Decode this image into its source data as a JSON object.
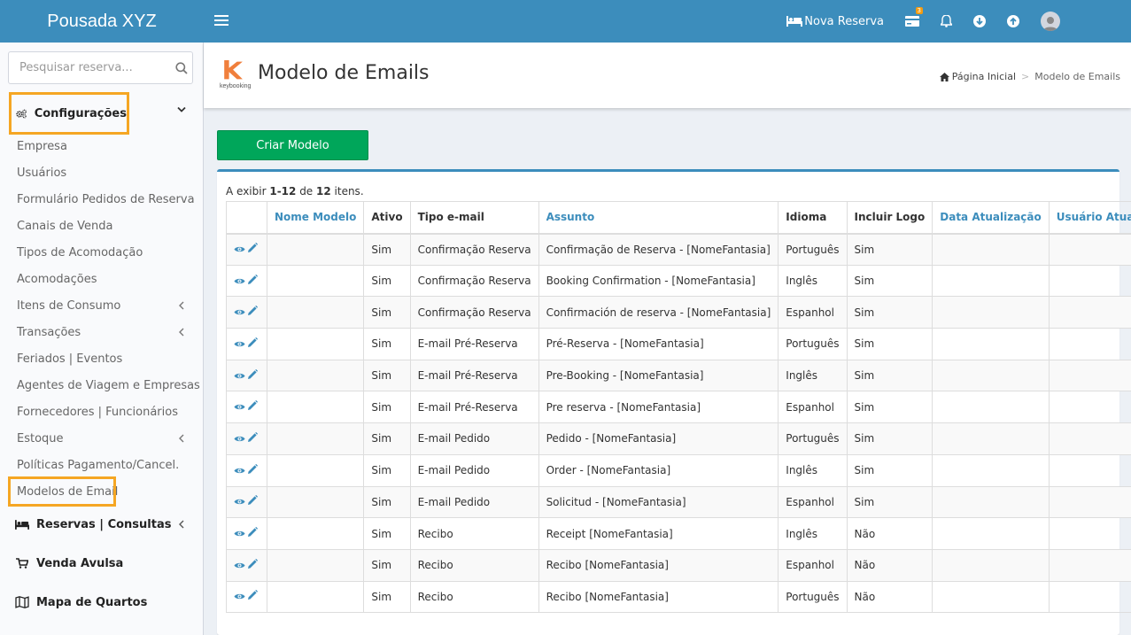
{
  "app": {
    "brand": "Pousada XYZ"
  },
  "topnav": {
    "nova_reserva": "Nova Reserva",
    "notification_count": "3"
  },
  "sidebar": {
    "search_placeholder": "Pesquisar reserva...",
    "section_title": "Configurações",
    "items": [
      {
        "label": "Empresa"
      },
      {
        "label": "Usuários"
      },
      {
        "label": "Formulário Pedidos de Reserva"
      },
      {
        "label": "Canais de Venda"
      },
      {
        "label": "Tipos de Acomodação"
      },
      {
        "label": "Acomodações"
      },
      {
        "label": "Itens de Consumo"
      },
      {
        "label": "Transações"
      },
      {
        "label": "Feriados | Eventos"
      },
      {
        "label": "Agentes de Viagem e Empresas"
      },
      {
        "label": "Fornecedores | Funcionários"
      },
      {
        "label": "Estoque"
      },
      {
        "label": "Políticas Pagamento/Cancel."
      },
      {
        "label": "Modelos de Email"
      }
    ],
    "main_items": [
      {
        "label": "Reservas | Consultas"
      },
      {
        "label": "Venda Avulsa"
      },
      {
        "label": "Mapa de Quartos"
      }
    ]
  },
  "header": {
    "logo_text": "keybooking",
    "title": "Modelo de Emails",
    "breadcrumb_home": "Página Inicial",
    "breadcrumb_sep": ">",
    "breadcrumb_current": "Modelo de Emails"
  },
  "content": {
    "create_button": "Criar Modelo",
    "summary_prefix": "A exibir ",
    "summary_range": "1-12",
    "summary_mid": " de ",
    "summary_total": "12",
    "summary_suffix": " itens."
  },
  "table": {
    "columns": [
      "Nome Modelo",
      "Ativo",
      "Tipo e-mail",
      "Assunto",
      "Idioma",
      "Incluir Logo",
      "Data Atualização",
      "Usuário Atualização"
    ],
    "rows": [
      {
        "nome": "",
        "ativo": "Sim",
        "tipo": "Confirmação Reserva",
        "assunto": "Confirmação de Reserva - [NomeFantasia]",
        "idioma": "Português",
        "logo": "Sim",
        "data": "",
        "usuario": ""
      },
      {
        "nome": "",
        "ativo": "Sim",
        "tipo": "Confirmação Reserva",
        "assunto": "Booking Confirmation - [NomeFantasia]",
        "idioma": "Inglês",
        "logo": "Sim",
        "data": "",
        "usuario": ""
      },
      {
        "nome": "",
        "ativo": "Sim",
        "tipo": "Confirmação Reserva",
        "assunto": "Confirmación de reserva - [NomeFantasia]",
        "idioma": "Espanhol",
        "logo": "Sim",
        "data": "",
        "usuario": ""
      },
      {
        "nome": "",
        "ativo": "Sim",
        "tipo": "E-mail Pré-Reserva",
        "assunto": "Pré-Reserva - [NomeFantasia]",
        "idioma": "Português",
        "logo": "Sim",
        "data": "",
        "usuario": ""
      },
      {
        "nome": "",
        "ativo": "Sim",
        "tipo": "E-mail Pré-Reserva",
        "assunto": "Pre-Booking - [NomeFantasia]",
        "idioma": "Inglês",
        "logo": "Sim",
        "data": "",
        "usuario": ""
      },
      {
        "nome": "",
        "ativo": "Sim",
        "tipo": "E-mail Pré-Reserva",
        "assunto": "Pre reserva - [NomeFantasia]",
        "idioma": "Espanhol",
        "logo": "Sim",
        "data": "",
        "usuario": ""
      },
      {
        "nome": "",
        "ativo": "Sim",
        "tipo": "E-mail Pedido",
        "assunto": "Pedido - [NomeFantasia]",
        "idioma": "Português",
        "logo": "Sim",
        "data": "",
        "usuario": ""
      },
      {
        "nome": "",
        "ativo": "Sim",
        "tipo": "E-mail Pedido",
        "assunto": "Order - [NomeFantasia]",
        "idioma": "Inglês",
        "logo": "Sim",
        "data": "",
        "usuario": ""
      },
      {
        "nome": "",
        "ativo": "Sim",
        "tipo": "E-mail Pedido",
        "assunto": "Solicitud - [NomeFantasia]",
        "idioma": "Espanhol",
        "logo": "Sim",
        "data": "",
        "usuario": ""
      },
      {
        "nome": "",
        "ativo": "Sim",
        "tipo": "Recibo",
        "assunto": "Receipt [NomeFantasia]",
        "idioma": "Inglês",
        "logo": "Não",
        "data": "",
        "usuario": ""
      },
      {
        "nome": "",
        "ativo": "Sim",
        "tipo": "Recibo",
        "assunto": "Recibo [NomeFantasia]",
        "idioma": "Espanhol",
        "logo": "Não",
        "data": "",
        "usuario": ""
      },
      {
        "nome": "",
        "ativo": "Sim",
        "tipo": "Recibo",
        "assunto": "Recibo [NomeFantasia]",
        "idioma": "Português",
        "logo": "Não",
        "data": "",
        "usuario": ""
      }
    ]
  },
  "colors": {
    "header_bg": "#3c8dbc",
    "accent_green": "#00a65a",
    "highlight_orange": "#f5a623",
    "link_blue": "#3c8dbc",
    "logo_orange": "#f07f3c"
  },
  "icons": {
    "view": "eye-icon",
    "edit": "pencil-icon"
  }
}
